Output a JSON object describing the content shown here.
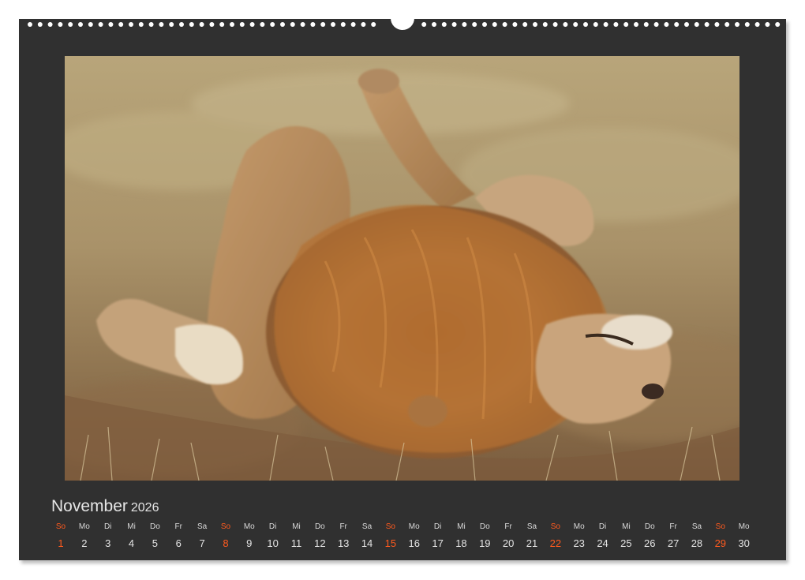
{
  "calendar": {
    "month": "November",
    "year": "2026",
    "accent_color": "#ff5a1e",
    "background_color": "#303030",
    "days": [
      {
        "wd": "So",
        "d": "1",
        "sunday": true
      },
      {
        "wd": "Mo",
        "d": "2"
      },
      {
        "wd": "Di",
        "d": "3"
      },
      {
        "wd": "Mi",
        "d": "4"
      },
      {
        "wd": "Do",
        "d": "5"
      },
      {
        "wd": "Fr",
        "d": "6"
      },
      {
        "wd": "Sa",
        "d": "7"
      },
      {
        "wd": "So",
        "d": "8",
        "sunday": true
      },
      {
        "wd": "Mo",
        "d": "9"
      },
      {
        "wd": "Di",
        "d": "10"
      },
      {
        "wd": "Mi",
        "d": "11"
      },
      {
        "wd": "Do",
        "d": "12"
      },
      {
        "wd": "Fr",
        "d": "13"
      },
      {
        "wd": "Sa",
        "d": "14"
      },
      {
        "wd": "So",
        "d": "15",
        "sunday": true
      },
      {
        "wd": "Mo",
        "d": "16"
      },
      {
        "wd": "Di",
        "d": "17"
      },
      {
        "wd": "Mi",
        "d": "18"
      },
      {
        "wd": "Do",
        "d": "19"
      },
      {
        "wd": "Fr",
        "d": "20"
      },
      {
        "wd": "Sa",
        "d": "21"
      },
      {
        "wd": "So",
        "d": "22",
        "sunday": true
      },
      {
        "wd": "Mo",
        "d": "23"
      },
      {
        "wd": "Di",
        "d": "24"
      },
      {
        "wd": "Mi",
        "d": "25"
      },
      {
        "wd": "Do",
        "d": "26"
      },
      {
        "wd": "Fr",
        "d": "27"
      },
      {
        "wd": "Sa",
        "d": "28"
      },
      {
        "wd": "So",
        "d": "29",
        "sunday": true
      },
      {
        "wd": "Mo",
        "d": "30"
      }
    ]
  }
}
